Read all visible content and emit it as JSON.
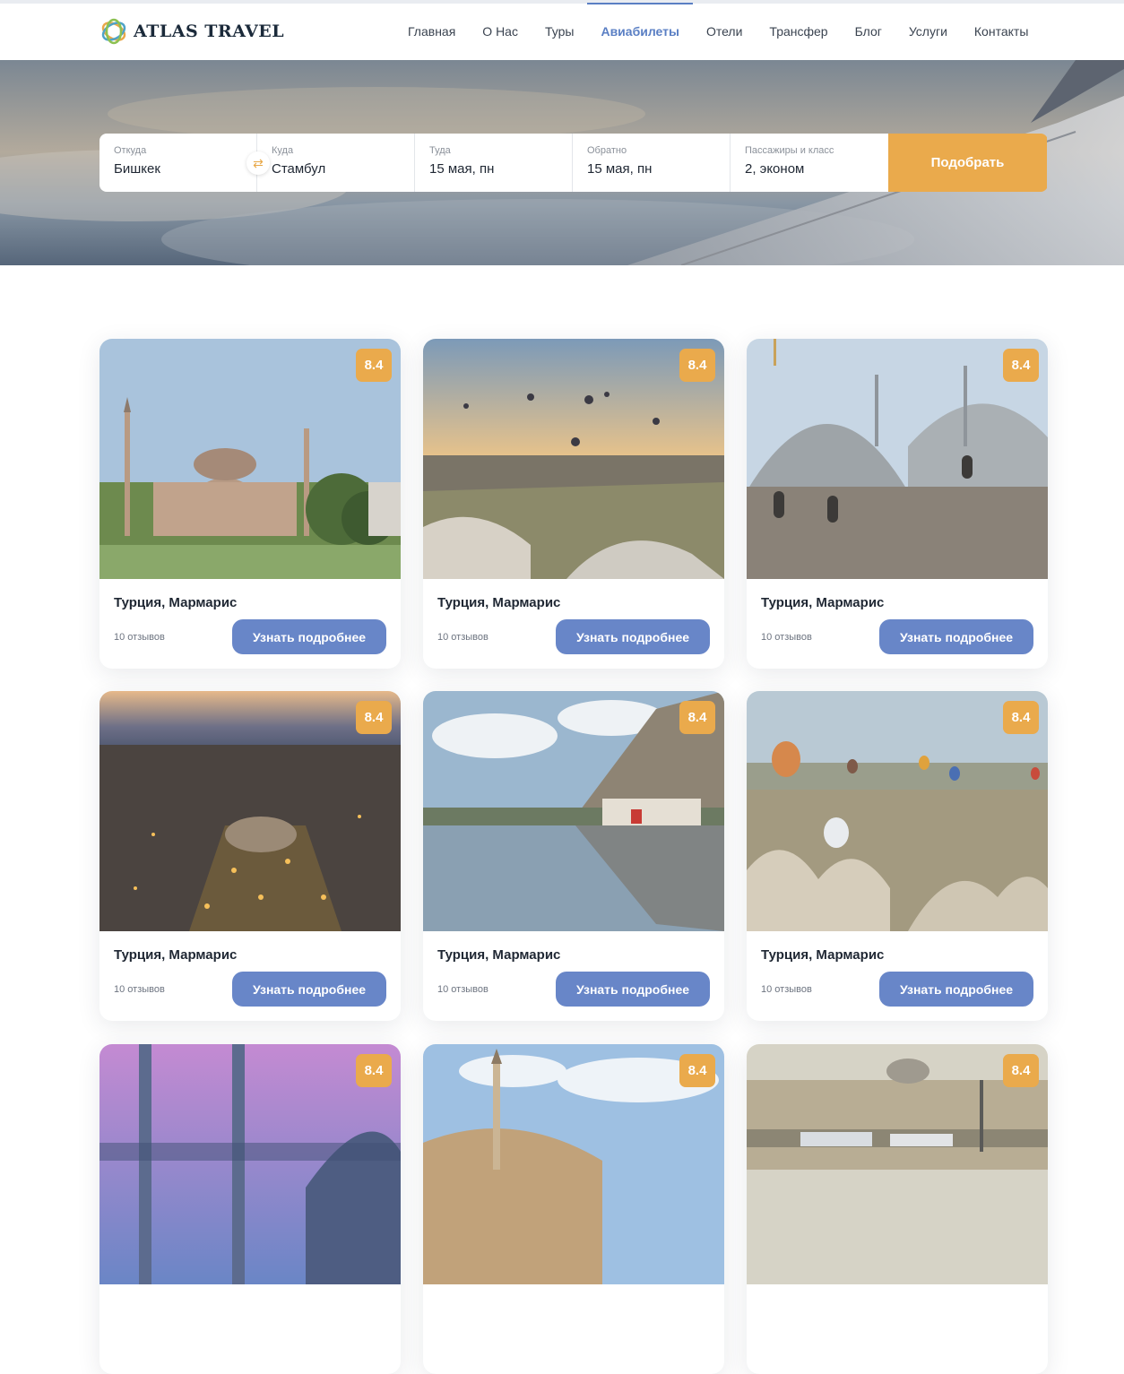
{
  "brand": {
    "name": "ATLAS TRAVEL",
    "accent": "#eaaa4c",
    "primary": "#6886c8"
  },
  "nav": [
    {
      "label": "Главная",
      "active": false
    },
    {
      "label": "О Нас",
      "active": false
    },
    {
      "label": "Туры",
      "active": false
    },
    {
      "label": "Авиабилеты",
      "active": true
    },
    {
      "label": "Отели",
      "active": false
    },
    {
      "label": "Трансфер",
      "active": false
    },
    {
      "label": "Блог",
      "active": false
    },
    {
      "label": "Услуги",
      "active": false
    },
    {
      "label": "Контакты",
      "active": false
    }
  ],
  "search": {
    "from": {
      "label": "Откуда",
      "value": "Бишкек"
    },
    "to": {
      "label": "Куда",
      "value": "Стамбул"
    },
    "depart": {
      "label": "Туда",
      "value": "15 мая, пн"
    },
    "return": {
      "label": "Обратно",
      "value": "15 мая, пн"
    },
    "passengers": {
      "label": "Пассажиры и класс",
      "value": "2, эконом"
    },
    "swap_icon": "swap-arrows-icon",
    "submit_label": "Подобрать"
  },
  "cards": [
    {
      "rating": "8.4",
      "title": "Турция, Мармарис",
      "reviews": "10 отзывов",
      "button": "Узнать подробнее",
      "image": "hagia-sophia"
    },
    {
      "rating": "8.4",
      "title": "Турция, Мармарис",
      "reviews": "10 отзывов",
      "button": "Узнать подробнее",
      "image": "cappadocia-balloons-sunrise"
    },
    {
      "rating": "8.4",
      "title": "Турция, Мармарис",
      "reviews": "10 отзывов",
      "button": "Узнать подробнее",
      "image": "mosque-domes"
    },
    {
      "rating": "8.4",
      "title": "Турция, Мармарис",
      "reviews": "10 отзывов",
      "button": "Узнать подробнее",
      "image": "istanbul-night-aerial"
    },
    {
      "rating": "8.4",
      "title": "Турция, Мармарис",
      "reviews": "10 отзывов",
      "button": "Узнать подробнее",
      "image": "amasya-river"
    },
    {
      "rating": "8.4",
      "title": "Турция, Мармарис",
      "reviews": "10 отзывов",
      "button": "Узнать подробнее",
      "image": "cappadocia-balloons-valley"
    },
    {
      "rating": "8.4",
      "title": "",
      "reviews": "",
      "button": "",
      "image": "minarets-dusk"
    },
    {
      "rating": "8.4",
      "title": "",
      "reviews": "",
      "button": "",
      "image": "desert-minaret"
    },
    {
      "rating": "8.4",
      "title": "",
      "reviews": "",
      "button": "",
      "image": "istanbul-street"
    }
  ]
}
